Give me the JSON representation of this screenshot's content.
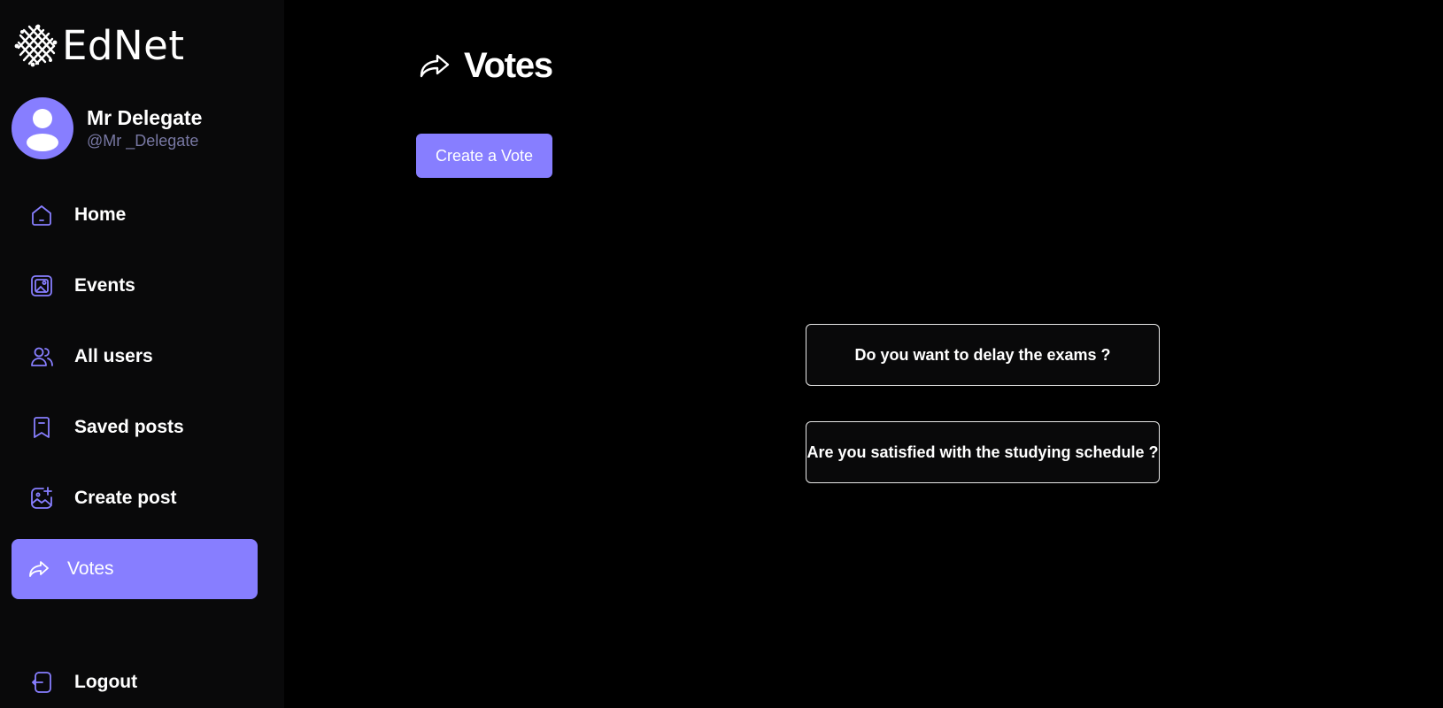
{
  "app": {
    "name": "EdNet"
  },
  "colors": {
    "accent": "#877eff",
    "sidebar_bg": "#09090a",
    "page_bg": "#000000",
    "handle_text": "#7878a3",
    "card_border": "#e8e8e8"
  },
  "profile": {
    "name": "Mr Delegate",
    "handle": "@Mr _Delegate",
    "avatar_icon": "user-avatar-icon"
  },
  "nav": {
    "items": [
      {
        "label": "Home",
        "icon": "home-icon",
        "active": false
      },
      {
        "label": "Events",
        "icon": "gallery-icon",
        "active": false
      },
      {
        "label": "All users",
        "icon": "people-icon",
        "active": false
      },
      {
        "label": "Saved posts",
        "icon": "bookmark-icon",
        "active": false
      },
      {
        "label": "Create post",
        "icon": "gallery-add-icon",
        "active": false
      },
      {
        "label": "Votes",
        "icon": "share-arrow-icon",
        "active": true
      }
    ],
    "logout": {
      "label": "Logout",
      "icon": "logout-icon"
    }
  },
  "main": {
    "title": "Votes",
    "title_icon": "share-arrow-icon",
    "create_button": "Create a Vote",
    "votes": [
      {
        "question": "Do you want to delay the exams ?"
      },
      {
        "question": "Are you satisfied with the studying schedule ?"
      }
    ]
  }
}
